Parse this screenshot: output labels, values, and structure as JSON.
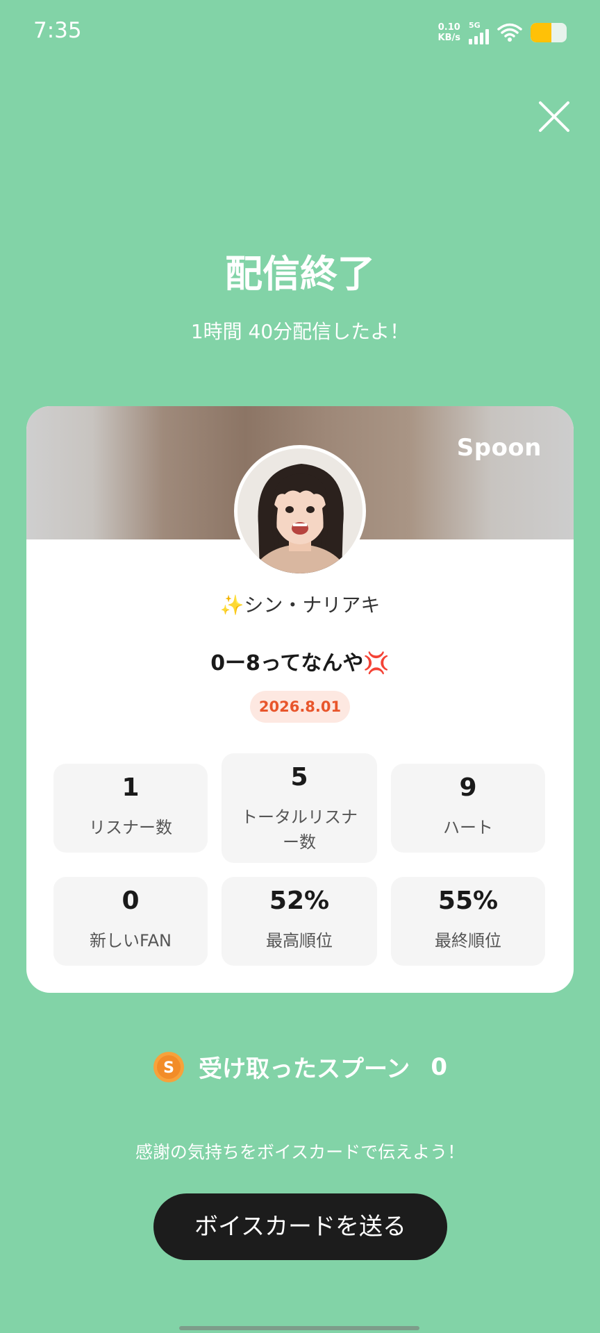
{
  "status_bar": {
    "time": "7:35",
    "net_speed_value": "0.10",
    "net_speed_unit": "KB/s",
    "network": "5G"
  },
  "header": {
    "title": "配信終了",
    "subtitle": "1時間 40分配信したよ！"
  },
  "card": {
    "brand": "Spoon",
    "host_name": "✨シン・ナリアキ",
    "stream_title": "0ー8ってなんや💢",
    "date": "2026.8.01",
    "stats": [
      {
        "value": "1",
        "label": "リスナー数"
      },
      {
        "value": "5",
        "label_line1": "トータルリスナ",
        "label_line2": "ー数"
      },
      {
        "value": "9",
        "label": "ハート"
      },
      {
        "value": "0",
        "label": "新しいFAN"
      },
      {
        "value": "52%",
        "label": "最高順位"
      },
      {
        "value": "55%",
        "label": "最終順位"
      }
    ]
  },
  "spoons": {
    "coin_letter": "S",
    "label": "受け取ったスプーン",
    "count": "0"
  },
  "thanks_message": "感謝の気持ちをボイスカードで伝えよう！",
  "send_button_label": "ボイスカードを送る",
  "colors": {
    "background": "#82d3a7",
    "date_badge_text": "#e8552b",
    "button": "#1c1c1c"
  }
}
